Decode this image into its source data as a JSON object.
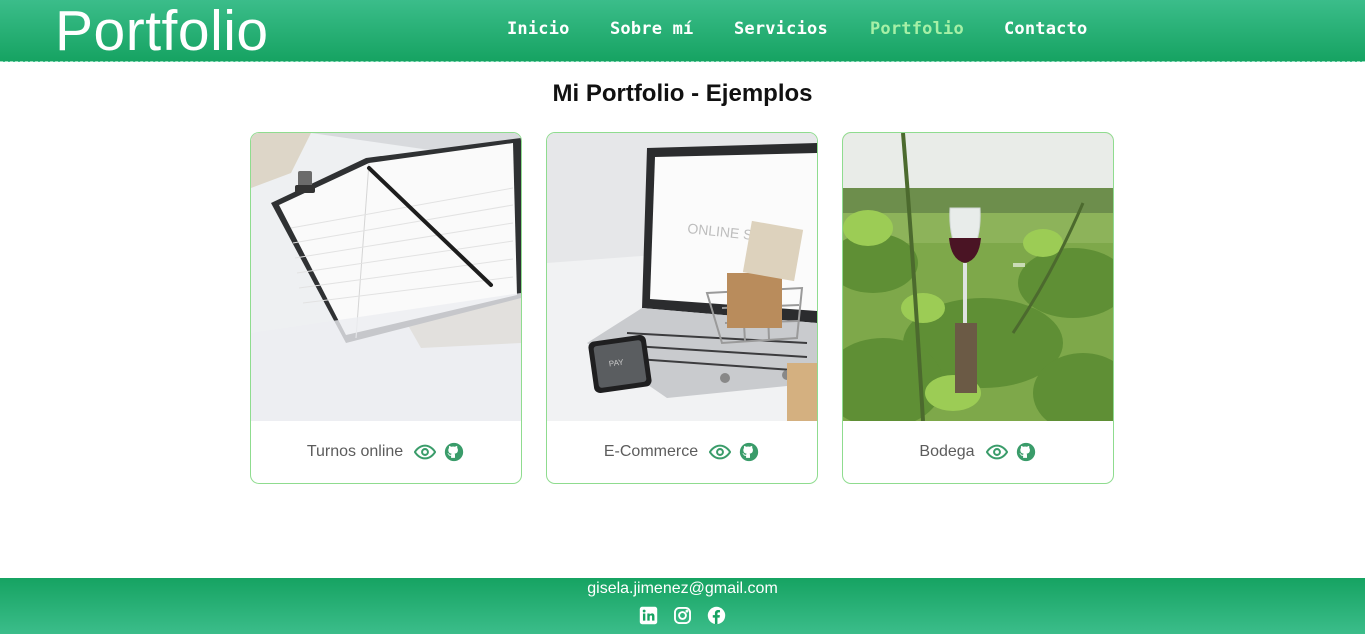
{
  "header": {
    "brand": "Portfolio",
    "nav": [
      {
        "label": "Inicio"
      },
      {
        "label": "Sobre mí"
      },
      {
        "label": "Servicios"
      },
      {
        "label": "Portfolio",
        "active": true
      },
      {
        "label": "Contacto"
      }
    ]
  },
  "main": {
    "title": "Mi Portfolio - Ejemplos",
    "cards": [
      {
        "label": "Turnos online",
        "image": "notebook-pencil-photo",
        "icons": [
          "eye-icon",
          "github-icon"
        ]
      },
      {
        "label": "E-Commerce",
        "image": "laptop-shopping-cart-photo",
        "icons": [
          "eye-icon",
          "github-icon"
        ]
      },
      {
        "label": "Bodega",
        "image": "wine-glass-vineyard-photo",
        "icons": [
          "eye-icon",
          "github-icon"
        ]
      }
    ]
  },
  "footer": {
    "email": "gisela.jimenez@gmail.com",
    "socials": [
      "linkedin-icon",
      "instagram-icon",
      "facebook-icon"
    ]
  },
  "colors": {
    "header_green": "#16a362",
    "active_nav": "#a6f0a6",
    "card_border": "#8fdc8f",
    "icon_green": "#3a9c6a"
  }
}
